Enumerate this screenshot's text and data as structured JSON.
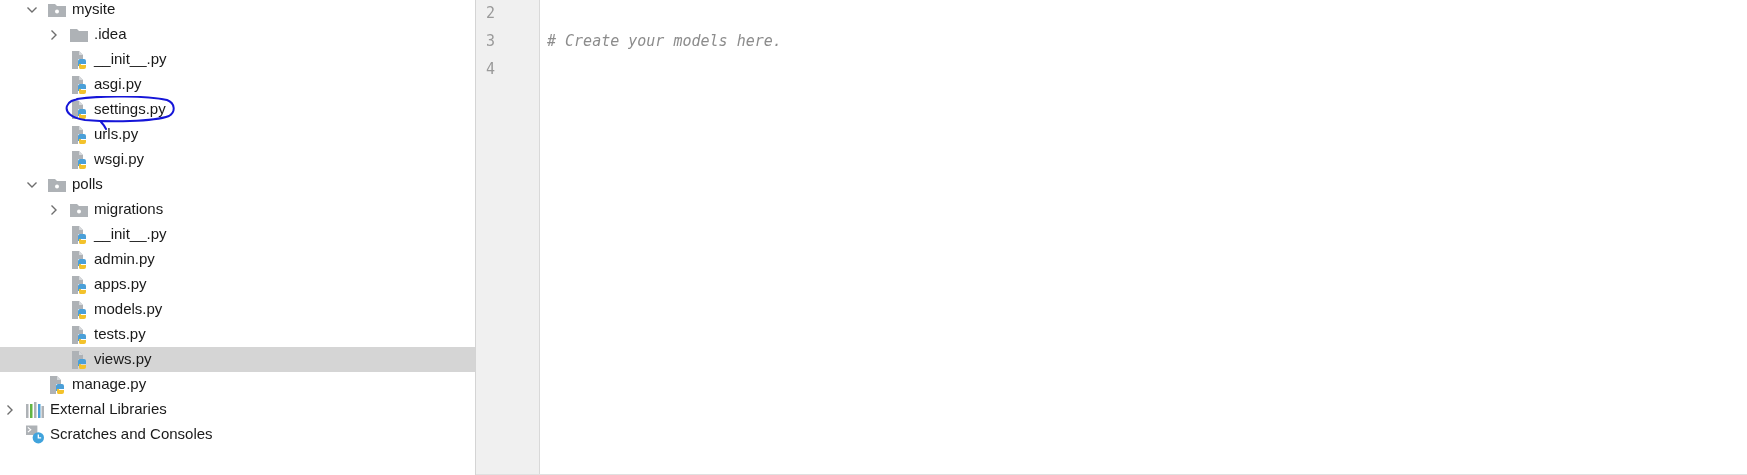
{
  "project_tree": [
    {
      "label": "mysite",
      "kind": "package",
      "expanded": true,
      "selected": false,
      "children": [
        {
          "label": ".idea",
          "kind": "folder",
          "expanded": false,
          "selected": false
        },
        {
          "label": "__init__.py",
          "kind": "python",
          "selected": false
        },
        {
          "label": "asgi.py",
          "kind": "python",
          "selected": false
        },
        {
          "label": "settings.py",
          "kind": "python",
          "selected": false
        },
        {
          "label": "urls.py",
          "kind": "python",
          "selected": false
        },
        {
          "label": "wsgi.py",
          "kind": "python",
          "selected": false
        }
      ]
    },
    {
      "label": "polls",
      "kind": "package",
      "expanded": true,
      "selected": false,
      "children": [
        {
          "label": "migrations",
          "kind": "package",
          "expanded": false,
          "selected": false
        },
        {
          "label": "__init__.py",
          "kind": "python",
          "selected": false
        },
        {
          "label": "admin.py",
          "kind": "python",
          "selected": false
        },
        {
          "label": "apps.py",
          "kind": "python",
          "selected": false
        },
        {
          "label": "models.py",
          "kind": "python",
          "selected": false
        },
        {
          "label": "tests.py",
          "kind": "python",
          "selected": false
        },
        {
          "label": "views.py",
          "kind": "python",
          "selected": true
        }
      ]
    },
    {
      "label": "manage.py",
      "kind": "python",
      "selected": false
    },
    {
      "label": "External Libraries",
      "kind": "libraries",
      "expanded": false,
      "selected": false,
      "root": true
    },
    {
      "label": "Scratches and Consoles",
      "kind": "scratches",
      "selected": false,
      "root": true
    }
  ],
  "editor": {
    "lines": [
      {
        "number": "2"
      },
      {
        "number": "3",
        "text": "# Create your models here."
      },
      {
        "number": "4"
      }
    ]
  }
}
